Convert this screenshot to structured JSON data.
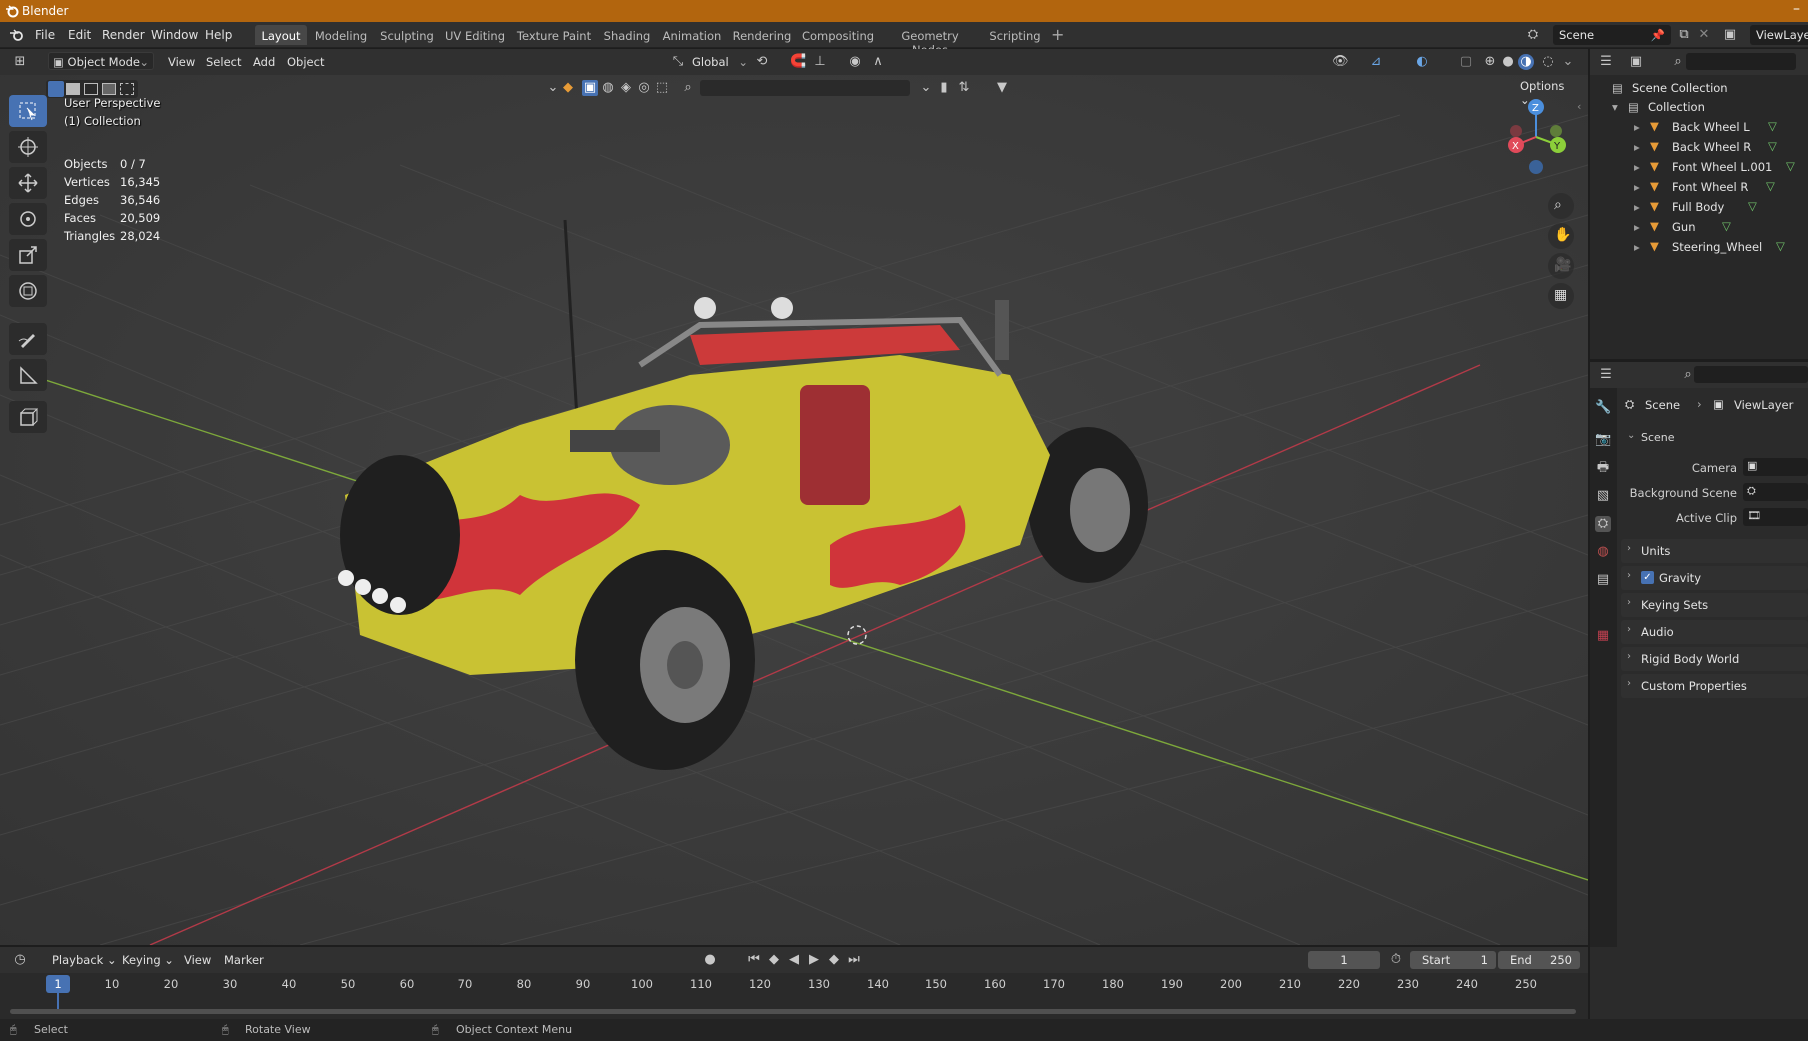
{
  "app": {
    "title": "Blender"
  },
  "menubar": {
    "items": [
      "File",
      "Edit",
      "Render",
      "Window",
      "Help"
    ],
    "workspaces": [
      "Layout",
      "Modeling",
      "Sculpting",
      "UV Editing",
      "Texture Paint",
      "Shading",
      "Animation",
      "Rendering",
      "Compositing",
      "Geometry Nodes",
      "Scripting"
    ],
    "active_workspace": "Layout",
    "scene_name": "Scene",
    "view_layer": "ViewLaye"
  },
  "viewport_header": {
    "mode": "Object Mode",
    "menus": [
      "View",
      "Select",
      "Add",
      "Object"
    ],
    "transform_orientation": "Global",
    "options_label": "Options"
  },
  "viewport": {
    "perspective_label": "User Perspective",
    "collection_label": "(1) Collection",
    "stats": [
      {
        "label": "Objects",
        "value": "0 / 7"
      },
      {
        "label": "Vertices",
        "value": "16,345"
      },
      {
        "label": "Edges",
        "value": "36,546"
      },
      {
        "label": "Faces",
        "value": "20,509"
      },
      {
        "label": "Triangles",
        "value": "28,024"
      }
    ],
    "gizmo_axes": {
      "x": "X",
      "y": "Y",
      "z": "Z"
    }
  },
  "outliner": {
    "scene_collection": "Scene Collection",
    "collection": "Collection",
    "objects": [
      "Back Wheel L",
      "Back Wheel R",
      "Font Wheel L.001",
      "Font Wheel R",
      "Full Body",
      "Gun",
      "Steering_Wheel"
    ]
  },
  "properties": {
    "breadcrumb_scene": "Scene",
    "breadcrumb_viewlayer": "ViewLayer",
    "section_title": "Scene",
    "fields": [
      {
        "label": "Camera"
      },
      {
        "label": "Background Scene"
      },
      {
        "label": "Active Clip"
      }
    ],
    "panels": [
      "Units",
      "Gravity",
      "Keying Sets",
      "Audio",
      "Rigid Body World",
      "Custom Properties"
    ],
    "gravity_checked": true
  },
  "timeline": {
    "menus": [
      "Playback",
      "Keying",
      "View",
      "Marker"
    ],
    "current_frame": "1",
    "start_label": "Start",
    "start_value": "1",
    "end_label": "End",
    "end_value": "250",
    "ruler": [
      "10",
      "20",
      "30",
      "40",
      "50",
      "60",
      "70",
      "80",
      "90",
      "100",
      "110",
      "120",
      "130",
      "140",
      "150",
      "160",
      "170",
      "180",
      "190",
      "200",
      "210",
      "220",
      "230",
      "240",
      "250"
    ],
    "playhead": "1"
  },
  "statusbar": {
    "items": [
      "Select",
      "Rotate View",
      "Object Context Menu"
    ]
  },
  "colors": {
    "title_bar": "#b2650e",
    "accent": "#4772b3",
    "x_axis": "#e04a5a",
    "y_axis": "#8ccf3a",
    "z_axis": "#4b8fdd"
  }
}
